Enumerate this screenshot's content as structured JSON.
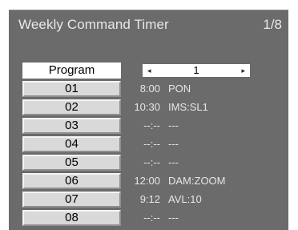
{
  "header": {
    "title": "Weekly Command Timer",
    "page": "1/8"
  },
  "program": {
    "label": "Program",
    "value": "1",
    "left_arrow": "◂",
    "right_arrow": "▸"
  },
  "rows": [
    {
      "num": "01",
      "time": "8:00",
      "command": "PON"
    },
    {
      "num": "02",
      "time": "10:30",
      "command": "IMS:SL1"
    },
    {
      "num": "03",
      "time": "--:--",
      "command": "---"
    },
    {
      "num": "04",
      "time": "--:--",
      "command": "---"
    },
    {
      "num": "05",
      "time": "--:--",
      "command": "---"
    },
    {
      "num": "06",
      "time": "12:00",
      "command": "DAM:ZOOM"
    },
    {
      "num": "07",
      "time": "9:12",
      "command": "AVL:10"
    },
    {
      "num": "08",
      "time": "--:--",
      "command": "---"
    }
  ],
  "colors": {
    "background": "#6b6b6b",
    "button": "#d9d9d9",
    "text_light": "#e6e6e6"
  }
}
